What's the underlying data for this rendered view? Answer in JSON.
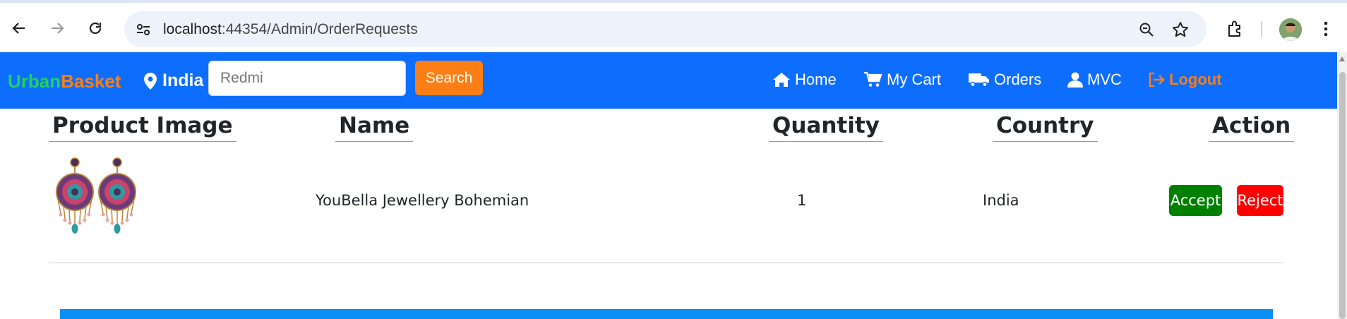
{
  "browser": {
    "url_host": "localhost",
    "url_path": ":44354/Admin/OrderRequests"
  },
  "navbar": {
    "brand_part1": "Urban",
    "brand_part2": "Basket",
    "location": "India",
    "search_placeholder": "Redmi",
    "search_button": "Search",
    "links": [
      {
        "label": "Home",
        "icon": "home-icon"
      },
      {
        "label": "My Cart",
        "icon": "cart-icon"
      },
      {
        "label": "Orders",
        "icon": "truck-icon"
      },
      {
        "label": "MVC",
        "icon": "user-icon"
      },
      {
        "label": "Logout",
        "icon": "logout-icon"
      }
    ]
  },
  "table": {
    "headers": [
      "Product Image",
      "Name",
      "Quantity",
      "Country",
      "Action"
    ],
    "rows": [
      {
        "image_alt": "earrings",
        "name": "YouBella Jewellery Bohemian",
        "quantity": "1",
        "country": "India",
        "accept_label": "Accept",
        "reject_label": "Reject"
      }
    ]
  },
  "colors": {
    "navbar": "#0d6efd",
    "brand_green": "#22d15a",
    "brand_orange": "#fd7e14",
    "accept": "#008000",
    "reject": "#ff0000"
  }
}
